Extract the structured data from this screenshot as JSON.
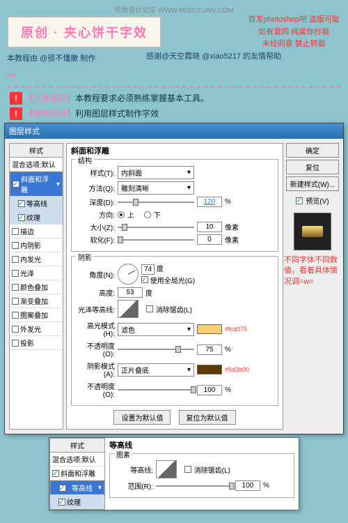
{
  "watermark": "思缘设计论坛   WWW.MISSYUAN.COM",
  "title": "原创 · 夹心饼干字效",
  "red_notes": [
    "首发photoshop吧  盗版可耻",
    "如有雷同  纯属你抄我",
    "未经同意  禁止转载"
  ],
  "credit1": "本教程由 @很不懂撒 制作",
  "credit2": "感谢@天空霞晓 @xiao5217 的友情帮助",
  "alerts": [
    {
      "ex": "!",
      "label": "【注意事项】",
      "text": "本教程要求必须熟练掌握基本工具。"
    },
    {
      "ex": "!",
      "label": "【教程原理】",
      "text": "利用图层样式制作字效"
    }
  ],
  "dlg_title": "图层样式",
  "styles_header": "样式",
  "styles": [
    {
      "label": "混合选项:默认",
      "cb": null
    },
    {
      "label": "斜面和浮雕",
      "cb": true,
      "sel": true
    },
    {
      "label": "等高线",
      "cb": true,
      "sub": true,
      "sel2": true
    },
    {
      "label": "纹理",
      "cb": true,
      "sub": true,
      "sel2": true
    },
    {
      "label": "描边",
      "cb": false
    },
    {
      "label": "内阴影",
      "cb": false
    },
    {
      "label": "内发光",
      "cb": false
    },
    {
      "label": "光泽",
      "cb": false
    },
    {
      "label": "颜色叠加",
      "cb": false
    },
    {
      "label": "渐变叠加",
      "cb": false
    },
    {
      "label": "图案叠加",
      "cb": false
    },
    {
      "label": "外发光",
      "cb": false
    },
    {
      "label": "投影",
      "cb": false
    }
  ],
  "section_title": "斜面和浮雕",
  "grp1": "结构",
  "style_lbl": "样式(T):",
  "style_val": "内斜面",
  "method_lbl": "方法(Q):",
  "method_val": "雕刻清晰",
  "depth_lbl": "深度(D):",
  "depth_val": "120",
  "pct": "%",
  "dir_lbl": "方向:",
  "dir_up": "上",
  "dir_down": "下",
  "size_lbl": "大小(Z):",
  "size_val": "10",
  "px": "像素",
  "soft_lbl": "软化(F):",
  "soft_val": "0",
  "grp2": "阴影",
  "angle_lbl": "角度(N):",
  "angle_val": "74",
  "deg": "度",
  "global_lbl": "使用全局光(G)",
  "alt_lbl": "高度:",
  "alt_val": "53",
  "gloss_lbl": "光泽等高线:",
  "aa_lbl": "消除锯齿(L)",
  "hl_mode_lbl": "高光模式(H):",
  "hl_mode_val": "滤色",
  "hl_hex": "#fcd075",
  "opacity_lbl": "不透明度(O):",
  "hl_op": "75",
  "sh_mode_lbl": "阴影模式(A):",
  "sh_mode_val": "正片叠底",
  "sh_hex": "#5d3b00",
  "sh_op": "100",
  "btn_default": "设置为默认值",
  "btn_reset": "复位为默认值",
  "btns": [
    "确定",
    "复位",
    "新建样式(W)..."
  ],
  "preview_lbl": "预览(V)",
  "side_note": "不同字体不同数值，看着具体情况调=w=",
  "d2": {
    "section": "等高线",
    "grp": "图素",
    "contour_lbl": "等高线:",
    "aa": "消除锯齿(L)",
    "range_lbl": "范围(R):",
    "range_val": "100"
  }
}
